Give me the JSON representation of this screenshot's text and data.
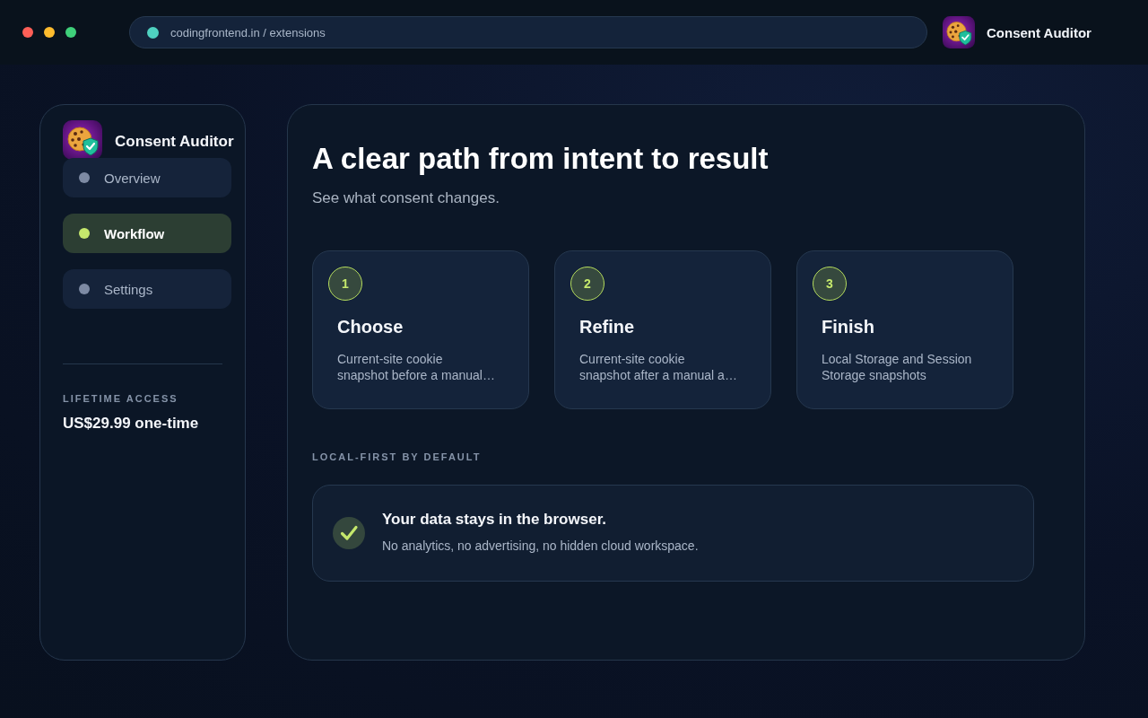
{
  "browser": {
    "url": "codingfrontend.in / extensions",
    "app_name": "Consent Auditor"
  },
  "sidebar": {
    "app_name": "Consent Auditor",
    "items": [
      {
        "label": "Overview",
        "selected": false
      },
      {
        "label": "Workflow",
        "selected": true
      },
      {
        "label": "Settings",
        "selected": false
      }
    ],
    "plan": {
      "label": "LIFETIME ACCESS",
      "price": "US$29.99 one-time"
    }
  },
  "main": {
    "title": "A clear path from intent to result",
    "subtitle": "See what consent changes.",
    "steps": [
      {
        "number": "1",
        "title": "Choose",
        "description": "Current-site cookie\nsnapshot before a manual…"
      },
      {
        "number": "2",
        "title": "Refine",
        "description": "Current-site cookie\nsnapshot after a manual a…"
      },
      {
        "number": "3",
        "title": "Finish",
        "description": "Local Storage and Session\nStorage snapshots"
      }
    ],
    "section_label": "LOCAL-FIRST BY DEFAULT",
    "notice": {
      "title": "Your data stays in the browser.",
      "description": "No analytics, no advertising, no hidden cloud workspace."
    }
  }
}
